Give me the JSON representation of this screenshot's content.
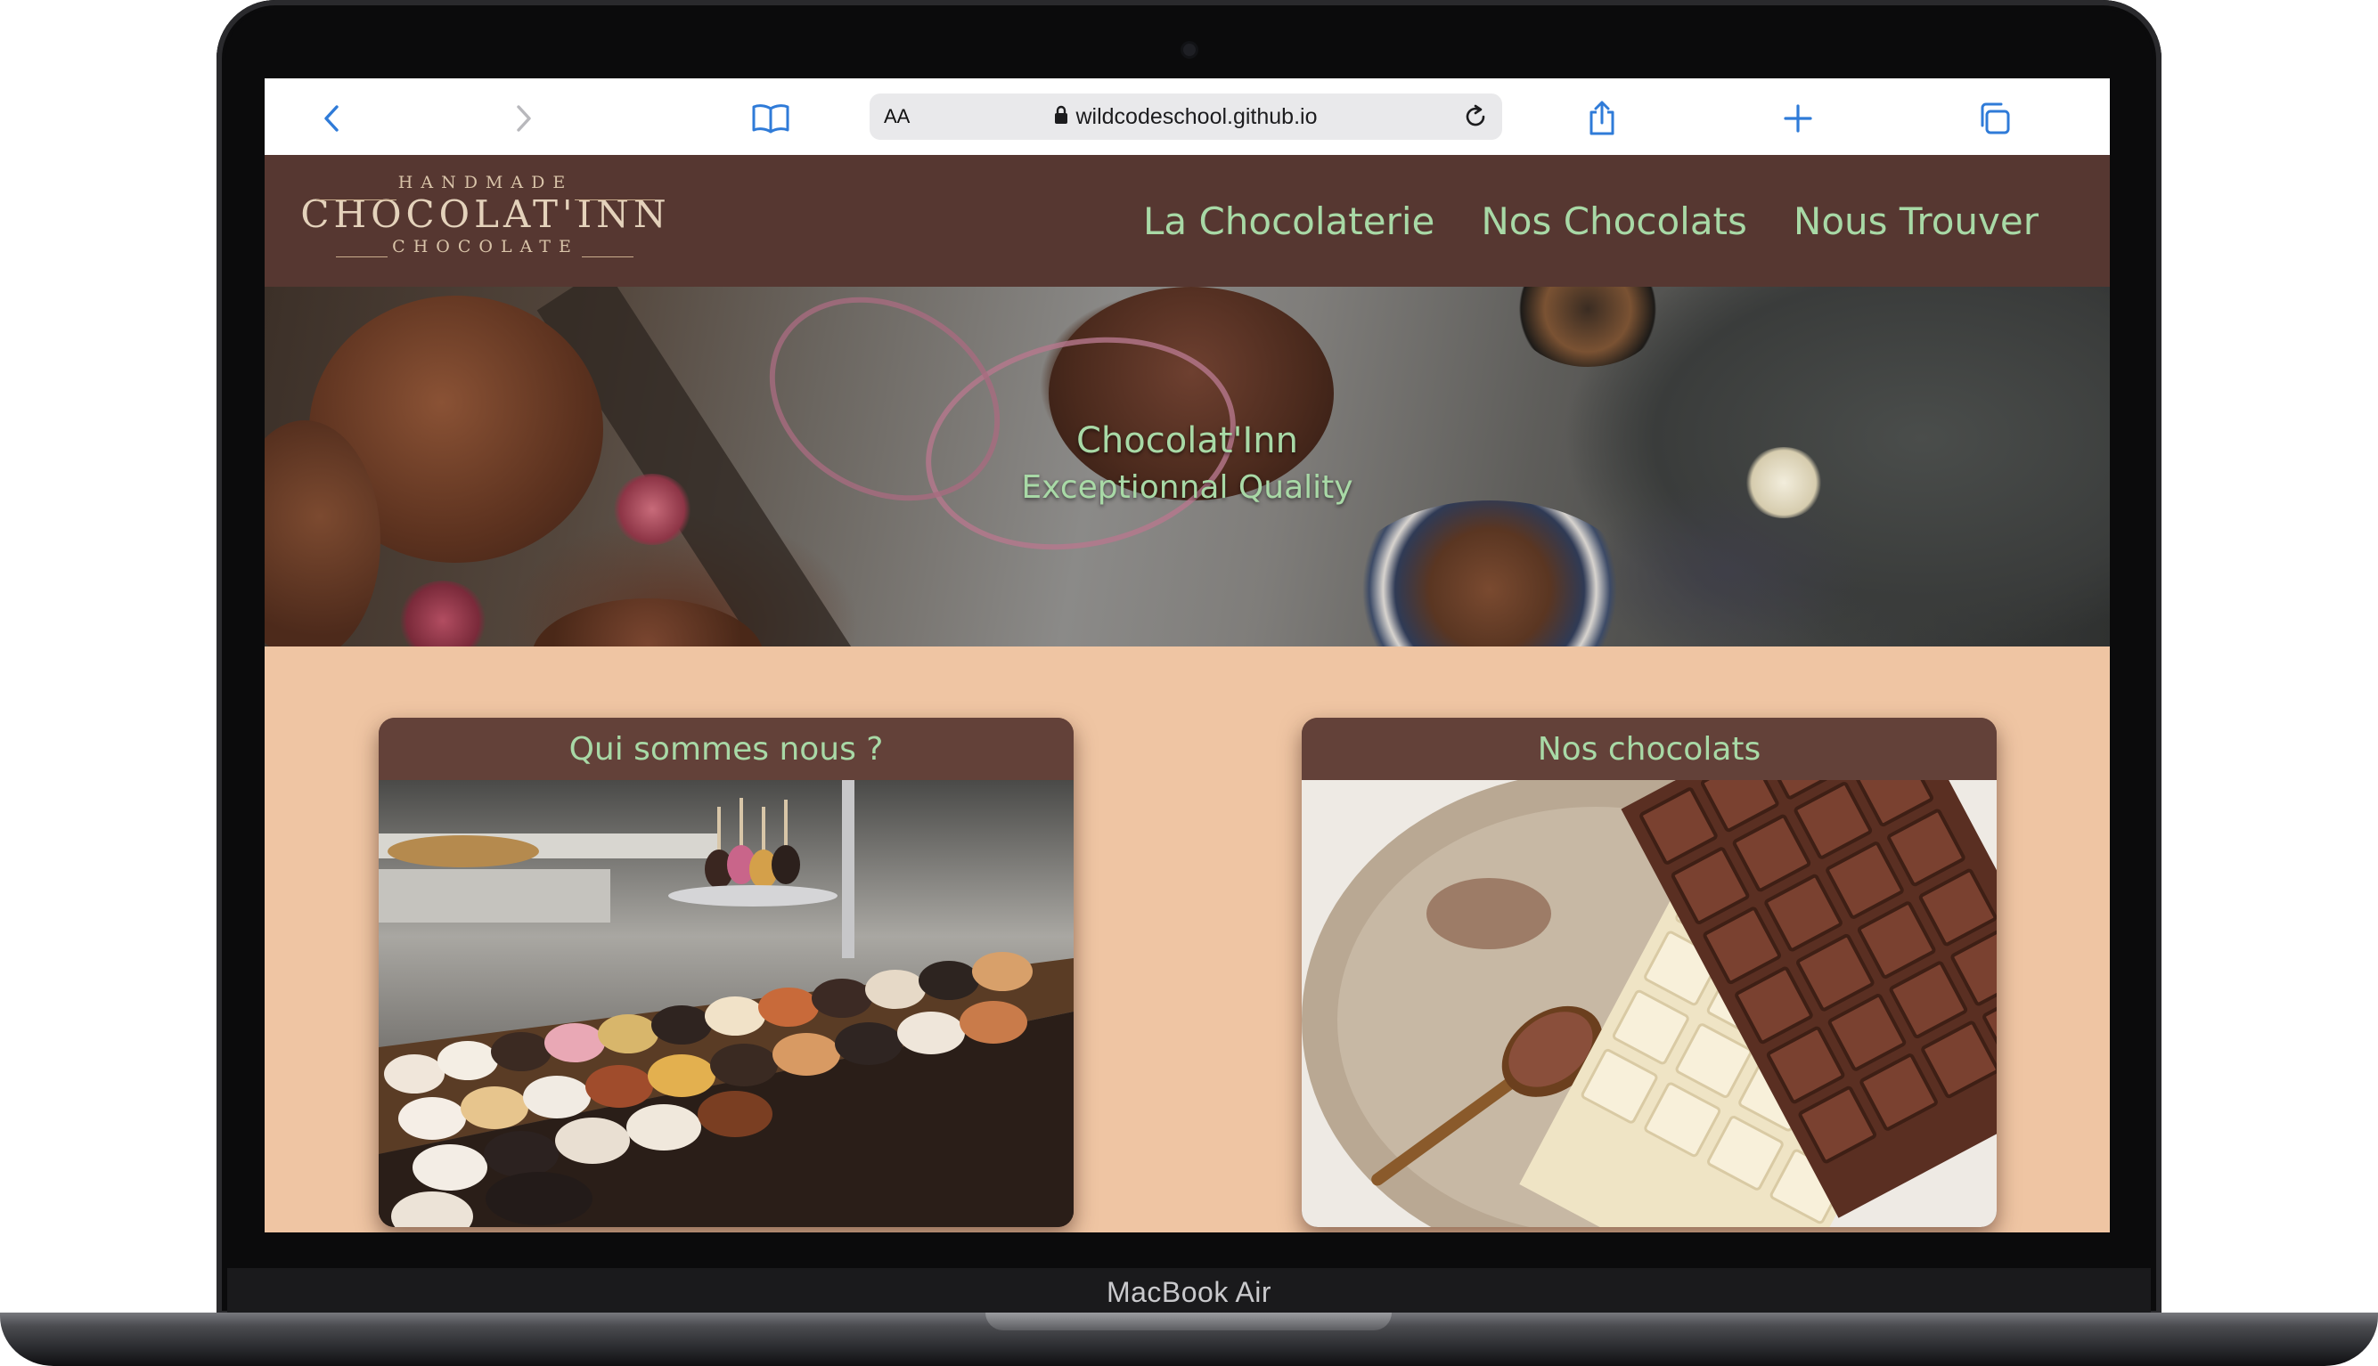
{
  "device": {
    "label": "MacBook Air"
  },
  "browser": {
    "reader_label": "AA",
    "url": "wildcodeschool.github.io",
    "icons": [
      "back-icon",
      "forward-icon",
      "bookmarks-icon",
      "lock-icon",
      "reload-icon",
      "share-icon",
      "new-tab-icon",
      "tabs-icon"
    ]
  },
  "site": {
    "logo": {
      "top": "HANDMADE",
      "main": "CHOCOLAT'INN",
      "bottom": "CHOCOLATE"
    },
    "nav": [
      {
        "label": "La Chocolaterie"
      },
      {
        "label": "Nos Chocolats"
      },
      {
        "label": "Nous Trouver"
      }
    ],
    "hero": {
      "title": "Chocolat'Inn",
      "subtitle": "Exceptionnal Quality"
    },
    "cards": [
      {
        "title": "Qui sommes nous ?"
      },
      {
        "title": "Nos chocolats"
      }
    ]
  },
  "colors": {
    "header_bg": "#563731",
    "accent_green": "#a8d9a6",
    "page_bg": "#efc5a3",
    "ios_blue": "#2f7bd8"
  }
}
